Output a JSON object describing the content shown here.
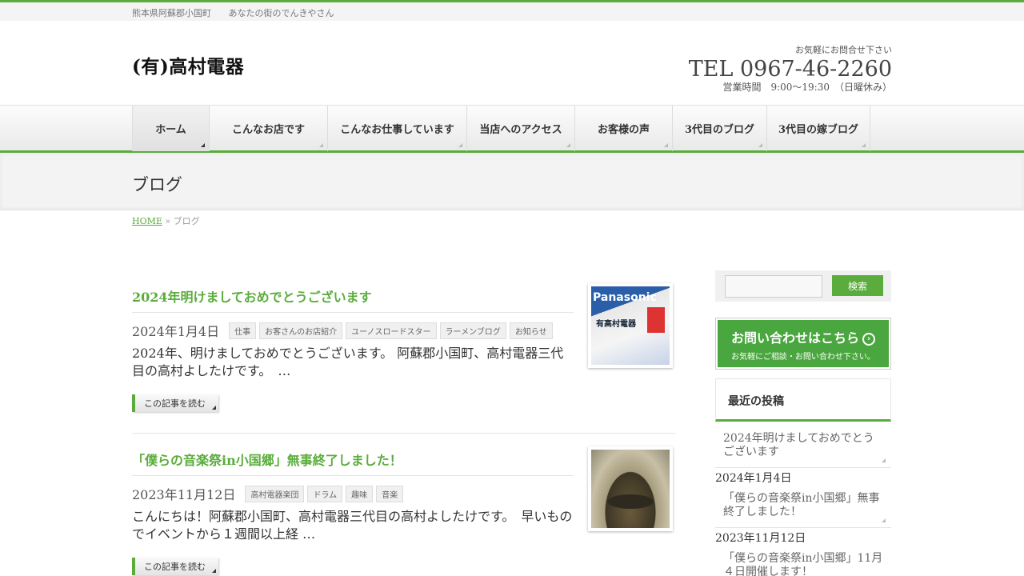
{
  "topbar": {
    "location": "熊本県阿蘇郡小国町",
    "tagline": "あなたの街のでんきやさん"
  },
  "header": {
    "logo": "(有)高村電器",
    "contact_note": "お気軽にお問合せ下さい",
    "tel": "TEL 0967-46-2260",
    "hours": "営業時間　9:00～19:30　（日曜休み）"
  },
  "nav": {
    "items": [
      {
        "label": "ホーム"
      },
      {
        "label": "こんなお店です"
      },
      {
        "label": "こんなお仕事しています"
      },
      {
        "label": "当店へのアクセス"
      },
      {
        "label": "お客様の声"
      },
      {
        "label": "3代目のブログ"
      },
      {
        "label": "3代目の嫁ブログ"
      }
    ]
  },
  "page": {
    "title": "ブログ"
  },
  "breadcrumb": {
    "home": "HOME",
    "sep": "»",
    "current": "ブログ"
  },
  "posts": [
    {
      "title": "2024年明けましておめでとうございます",
      "date": "2024年1月4日",
      "tags": [
        "仕事",
        "お客さんのお店紹介",
        "ユーノスロードスター",
        "ラーメンブログ",
        "お知らせ"
      ],
      "excerpt": "2024年、明けましておめでとうございます。 阿蘇郡小国町、高村電器三代目の高村よしたけです。　…",
      "more": "この記事を読む",
      "thumb_brand": "Panasonic",
      "thumb_shop": "有高村電器"
    },
    {
      "title": "「僕らの音楽祭in小国郷」無事終了しました！",
      "date": "2023年11月12日",
      "tags": [
        "高村電器楽団",
        "ドラム",
        "趣味",
        "音楽"
      ],
      "excerpt": "こんにちは！阿蘇郡小国町、高村電器三代目の高村よしたけです。　早いものでイベントから１週間以上経 …",
      "more": "この記事を読む"
    }
  ],
  "sidebar": {
    "search_button": "検索",
    "banner_big": "お問い合わせはこちら",
    "banner_small": "お気軽にご相談・お問い合わせ下さい。",
    "recent_title": "最近の投稿",
    "recent": [
      {
        "title": "2024年明けましておめでとうございます",
        "date": "2024年1月4日"
      },
      {
        "title": "「僕らの音楽祭in小国郷」無事終了しました！",
        "date": "2023年11月12日"
      },
      {
        "title": "「僕らの音楽祭in小国郷」11月４日開催します！"
      }
    ]
  },
  "colors": {
    "accent": "#5aac3c"
  }
}
